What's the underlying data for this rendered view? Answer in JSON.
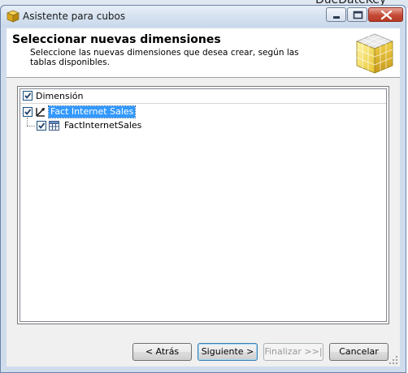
{
  "background_window": {
    "partial_text": "DueDateKey"
  },
  "window": {
    "title": "Asistente para cubos",
    "controls": [
      "minimize",
      "maximize",
      "close"
    ]
  },
  "header": {
    "title": "Seleccionar nuevas dimensiones",
    "description": "Seleccione las nuevas dimensiones que desea crear, según las tablas disponibles."
  },
  "tree": {
    "column_header": "Dimensión",
    "header_checked": true,
    "nodes": [
      {
        "label": "Fact Internet Sales",
        "checked": true,
        "selected": true,
        "icon": "dimension-icon",
        "children": [
          {
            "label": "FactInternetSales",
            "checked": true,
            "icon": "table-icon"
          }
        ]
      }
    ]
  },
  "buttons": {
    "back": "< Atrás",
    "next": "Siguiente >",
    "finish": "Finalizar >>|",
    "cancel": "Cancelar"
  },
  "colors": {
    "selection": "#3399ff",
    "chrome": "#cfdcec",
    "close_button": "#c44a36"
  }
}
